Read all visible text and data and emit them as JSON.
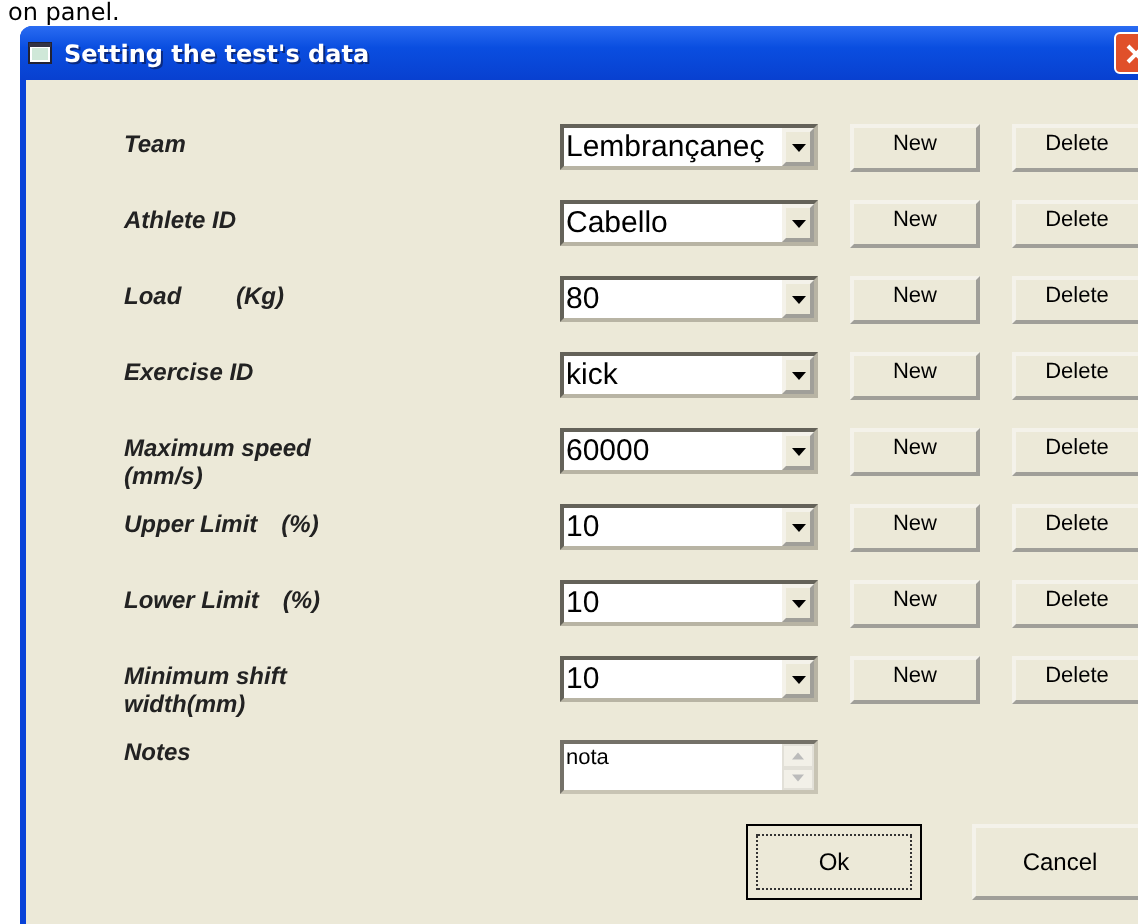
{
  "background_text": "on panel.",
  "window": {
    "title": "Setting the test's data"
  },
  "fields": [
    {
      "kind": "combo",
      "label": "Team",
      "value": "Lembrançaneç",
      "buttons": [
        "New",
        "Delete"
      ]
    },
    {
      "kind": "combo",
      "label": "Athlete ID",
      "value": "Cabello",
      "buttons": [
        "New",
        "Delete"
      ]
    },
    {
      "kind": "combo",
      "label": "Load",
      "unit": "(Kg)",
      "value": "80",
      "buttons": [
        "New",
        "Delete"
      ]
    },
    {
      "kind": "combo",
      "label": "Exercise ID",
      "value": "kick",
      "buttons": [
        "New",
        "Delete"
      ]
    },
    {
      "kind": "combo",
      "label": "Maximum speed (mm/s)",
      "value": "60000",
      "buttons": [
        "New",
        "Delete"
      ]
    },
    {
      "kind": "combo",
      "label": "Upper Limit",
      "unit": "(%)",
      "value": "10",
      "buttons": [
        "New",
        "Delete"
      ]
    },
    {
      "kind": "combo",
      "label": "Lower Limit",
      "unit": "(%)",
      "value": "10",
      "buttons": [
        "New",
        "Delete"
      ]
    },
    {
      "kind": "combo",
      "label": "Minimum shift width(mm)",
      "value": "10",
      "buttons": [
        "New",
        "Delete"
      ]
    },
    {
      "kind": "memo",
      "label": "Notes",
      "value": "nota"
    }
  ],
  "footer_buttons": [
    {
      "label": "Ok",
      "default": true
    },
    {
      "label": "Cancel",
      "default": false
    }
  ]
}
